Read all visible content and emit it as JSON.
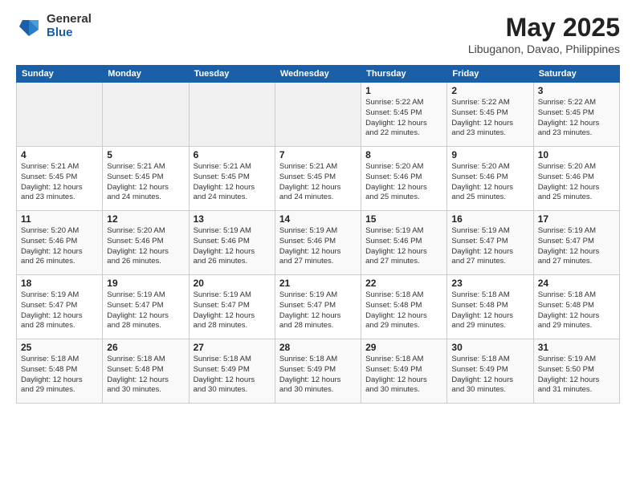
{
  "header": {
    "logo_general": "General",
    "logo_blue": "Blue",
    "month_title": "May 2025",
    "location": "Libuganon, Davao, Philippines"
  },
  "weekdays": [
    "Sunday",
    "Monday",
    "Tuesday",
    "Wednesday",
    "Thursday",
    "Friday",
    "Saturday"
  ],
  "weeks": [
    [
      {
        "day": "",
        "detail": ""
      },
      {
        "day": "",
        "detail": ""
      },
      {
        "day": "",
        "detail": ""
      },
      {
        "day": "",
        "detail": ""
      },
      {
        "day": "1",
        "detail": "Sunrise: 5:22 AM\nSunset: 5:45 PM\nDaylight: 12 hours\nand 22 minutes."
      },
      {
        "day": "2",
        "detail": "Sunrise: 5:22 AM\nSunset: 5:45 PM\nDaylight: 12 hours\nand 23 minutes."
      },
      {
        "day": "3",
        "detail": "Sunrise: 5:22 AM\nSunset: 5:45 PM\nDaylight: 12 hours\nand 23 minutes."
      }
    ],
    [
      {
        "day": "4",
        "detail": "Sunrise: 5:21 AM\nSunset: 5:45 PM\nDaylight: 12 hours\nand 23 minutes."
      },
      {
        "day": "5",
        "detail": "Sunrise: 5:21 AM\nSunset: 5:45 PM\nDaylight: 12 hours\nand 24 minutes."
      },
      {
        "day": "6",
        "detail": "Sunrise: 5:21 AM\nSunset: 5:45 PM\nDaylight: 12 hours\nand 24 minutes."
      },
      {
        "day": "7",
        "detail": "Sunrise: 5:21 AM\nSunset: 5:45 PM\nDaylight: 12 hours\nand 24 minutes."
      },
      {
        "day": "8",
        "detail": "Sunrise: 5:20 AM\nSunset: 5:46 PM\nDaylight: 12 hours\nand 25 minutes."
      },
      {
        "day": "9",
        "detail": "Sunrise: 5:20 AM\nSunset: 5:46 PM\nDaylight: 12 hours\nand 25 minutes."
      },
      {
        "day": "10",
        "detail": "Sunrise: 5:20 AM\nSunset: 5:46 PM\nDaylight: 12 hours\nand 25 minutes."
      }
    ],
    [
      {
        "day": "11",
        "detail": "Sunrise: 5:20 AM\nSunset: 5:46 PM\nDaylight: 12 hours\nand 26 minutes."
      },
      {
        "day": "12",
        "detail": "Sunrise: 5:20 AM\nSunset: 5:46 PM\nDaylight: 12 hours\nand 26 minutes."
      },
      {
        "day": "13",
        "detail": "Sunrise: 5:19 AM\nSunset: 5:46 PM\nDaylight: 12 hours\nand 26 minutes."
      },
      {
        "day": "14",
        "detail": "Sunrise: 5:19 AM\nSunset: 5:46 PM\nDaylight: 12 hours\nand 27 minutes."
      },
      {
        "day": "15",
        "detail": "Sunrise: 5:19 AM\nSunset: 5:46 PM\nDaylight: 12 hours\nand 27 minutes."
      },
      {
        "day": "16",
        "detail": "Sunrise: 5:19 AM\nSunset: 5:47 PM\nDaylight: 12 hours\nand 27 minutes."
      },
      {
        "day": "17",
        "detail": "Sunrise: 5:19 AM\nSunset: 5:47 PM\nDaylight: 12 hours\nand 27 minutes."
      }
    ],
    [
      {
        "day": "18",
        "detail": "Sunrise: 5:19 AM\nSunset: 5:47 PM\nDaylight: 12 hours\nand 28 minutes."
      },
      {
        "day": "19",
        "detail": "Sunrise: 5:19 AM\nSunset: 5:47 PM\nDaylight: 12 hours\nand 28 minutes."
      },
      {
        "day": "20",
        "detail": "Sunrise: 5:19 AM\nSunset: 5:47 PM\nDaylight: 12 hours\nand 28 minutes."
      },
      {
        "day": "21",
        "detail": "Sunrise: 5:19 AM\nSunset: 5:47 PM\nDaylight: 12 hours\nand 28 minutes."
      },
      {
        "day": "22",
        "detail": "Sunrise: 5:18 AM\nSunset: 5:48 PM\nDaylight: 12 hours\nand 29 minutes."
      },
      {
        "day": "23",
        "detail": "Sunrise: 5:18 AM\nSunset: 5:48 PM\nDaylight: 12 hours\nand 29 minutes."
      },
      {
        "day": "24",
        "detail": "Sunrise: 5:18 AM\nSunset: 5:48 PM\nDaylight: 12 hours\nand 29 minutes."
      }
    ],
    [
      {
        "day": "25",
        "detail": "Sunrise: 5:18 AM\nSunset: 5:48 PM\nDaylight: 12 hours\nand 29 minutes."
      },
      {
        "day": "26",
        "detail": "Sunrise: 5:18 AM\nSunset: 5:48 PM\nDaylight: 12 hours\nand 30 minutes."
      },
      {
        "day": "27",
        "detail": "Sunrise: 5:18 AM\nSunset: 5:49 PM\nDaylight: 12 hours\nand 30 minutes."
      },
      {
        "day": "28",
        "detail": "Sunrise: 5:18 AM\nSunset: 5:49 PM\nDaylight: 12 hours\nand 30 minutes."
      },
      {
        "day": "29",
        "detail": "Sunrise: 5:18 AM\nSunset: 5:49 PM\nDaylight: 12 hours\nand 30 minutes."
      },
      {
        "day": "30",
        "detail": "Sunrise: 5:18 AM\nSunset: 5:49 PM\nDaylight: 12 hours\nand 30 minutes."
      },
      {
        "day": "31",
        "detail": "Sunrise: 5:19 AM\nSunset: 5:50 PM\nDaylight: 12 hours\nand 31 minutes."
      }
    ]
  ]
}
